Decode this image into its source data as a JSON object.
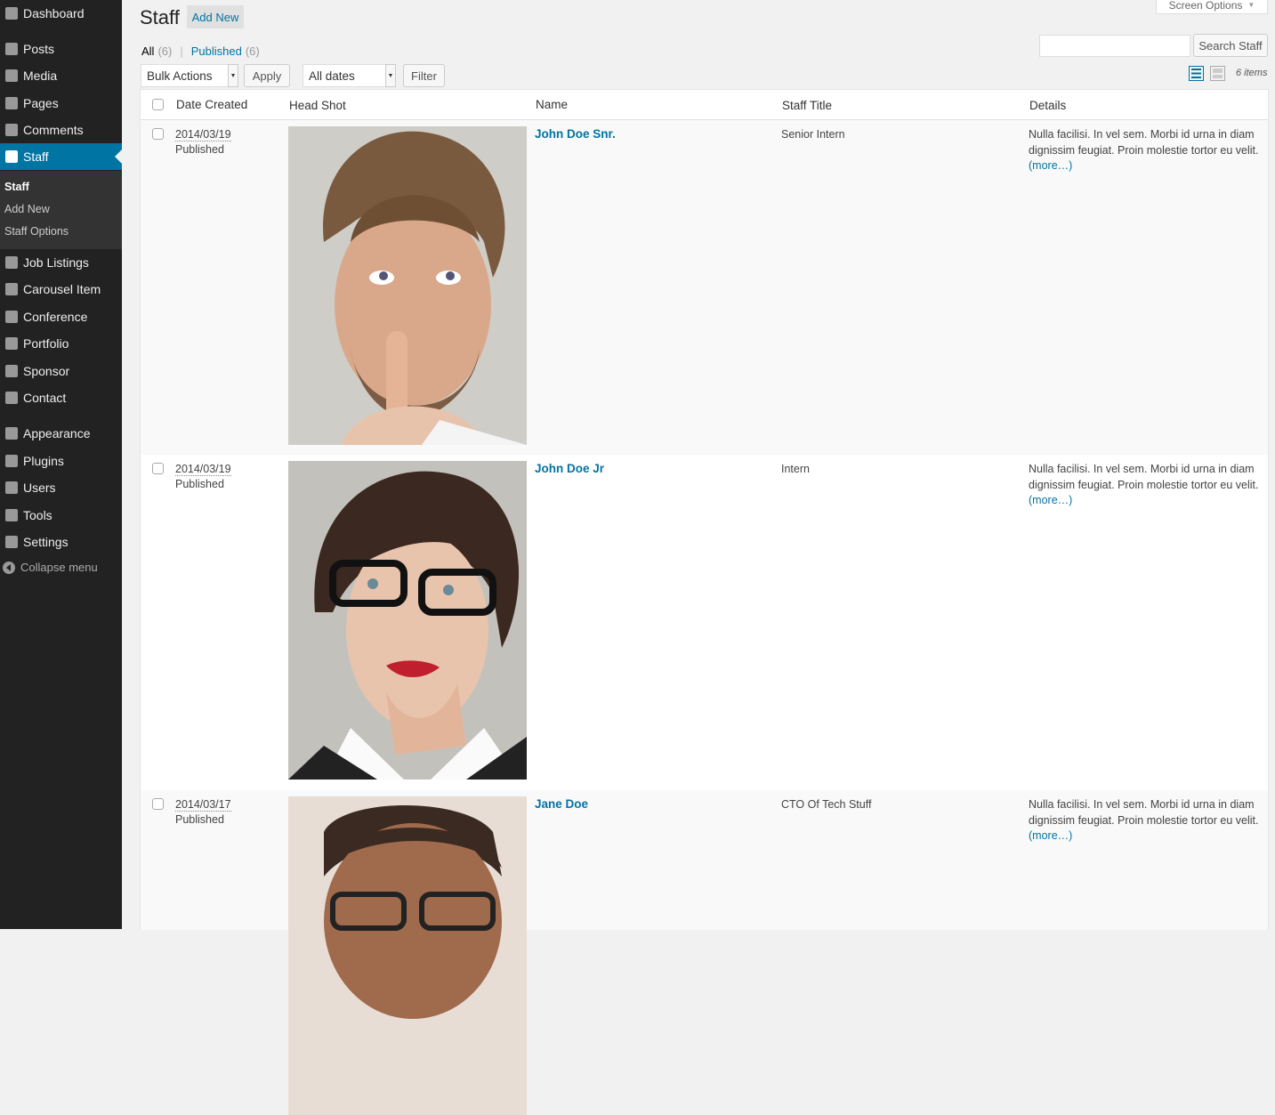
{
  "sidebar": {
    "items": [
      {
        "label": "Dashboard",
        "icon": "dashboard-icon"
      },
      {
        "label": "Posts",
        "icon": "pin-icon"
      },
      {
        "label": "Media",
        "icon": "media-icon"
      },
      {
        "label": "Pages",
        "icon": "pages-icon"
      },
      {
        "label": "Comments",
        "icon": "comment-icon"
      },
      {
        "label": "Staff",
        "icon": "staff-icon",
        "current": true
      },
      {
        "label": "Job Listings",
        "icon": "listing-icon"
      },
      {
        "label": "Carousel Item",
        "icon": "carousel-icon"
      },
      {
        "label": "Conference",
        "icon": "calendar-icon"
      },
      {
        "label": "Portfolio",
        "icon": "folder-icon"
      },
      {
        "label": "Sponsor",
        "icon": "user-group-icon"
      },
      {
        "label": "Contact",
        "icon": "gear-icon"
      },
      {
        "label": "Appearance",
        "icon": "paintbrush-icon"
      },
      {
        "label": "Plugins",
        "icon": "plugin-icon"
      },
      {
        "label": "Users",
        "icon": "user-icon"
      },
      {
        "label": "Tools",
        "icon": "wrench-icon"
      },
      {
        "label": "Settings",
        "icon": "settings-icon"
      }
    ],
    "submenu": [
      "Staff",
      "Add New",
      "Staff Options"
    ],
    "collapse_label": "Collapse menu"
  },
  "header": {
    "title": "Staff",
    "add_new": "Add New",
    "screen_options": "Screen Options"
  },
  "filters": {
    "all_label": "All",
    "all_count": "(6)",
    "separator": "|",
    "published_label": "Published",
    "published_count": "(6)"
  },
  "search": {
    "value": "",
    "button": "Search Staff"
  },
  "toolbar": {
    "bulk_actions": "Bulk Actions",
    "apply": "Apply",
    "dates": "All dates",
    "filter": "Filter",
    "items_count": "6 items"
  },
  "table": {
    "columns": [
      "Date Created",
      "Head Shot",
      "Name",
      "Staff Title",
      "Details"
    ],
    "rows": [
      {
        "date": "2014/03/19",
        "status": "Published",
        "name": "John Doe Snr.",
        "title": "Senior Intern",
        "details": "Nulla facilisi. In vel sem. Morbi id urna in diam dignissim feugiat. Proin molestie tortor eu velit.",
        "more": "(more…)"
      },
      {
        "date": "2014/03/19",
        "status": "Published",
        "name": "John Doe Jr",
        "title": "Intern",
        "details": "Nulla facilisi. In vel sem. Morbi id urna in diam dignissim feugiat. Proin molestie tortor eu velit.",
        "more": "(more…)"
      },
      {
        "date": "2014/03/17",
        "status": "Published",
        "name": "Jane Doe",
        "title": "CTO Of Tech Stuff",
        "details": "Nulla facilisi. In vel sem. Morbi id urna in diam dignissim feugiat. Proin molestie tortor eu velit.",
        "more": "(more…)"
      }
    ]
  },
  "colors": {
    "sidebar_bg": "#222222",
    "accent": "#0074a2",
    "page_bg": "#f1f1f1"
  }
}
